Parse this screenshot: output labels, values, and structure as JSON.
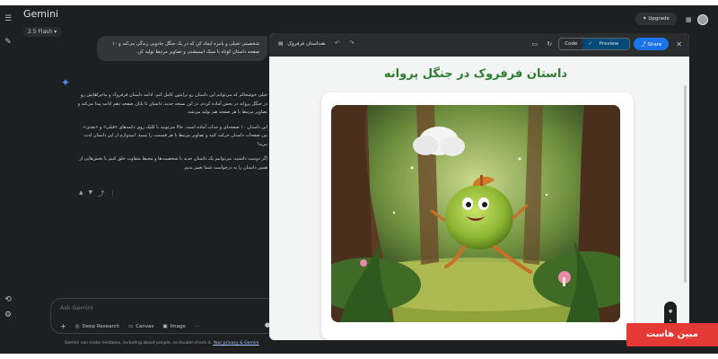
{
  "app": {
    "name": "Gemini",
    "model": "2.5 Flash ▾"
  },
  "header": {
    "upgrade_label": "Upgrade"
  },
  "chat": {
    "user_message": "شخصیتی تخیلی و بامزه ایجاد کن که در یک جنگل جادویی زندگی می‌کند و ۱۰ صفحه داستان کوتاه با سبک انیمیشنی و تصاویر مرتبط تولید کن.",
    "reply_paragraphs": [
      "خیلی خوشحالم که می‌توانم این داستان رو برایتون کامل کنم. ادامه داستان فرفروک و ماجراهایش رو در جنگل پروانه در بخش آماده کردم. در این نسخه جدید، داستان تا پایان صفحه دهم ادامه پیدا می‌کنه و تصاویر مرتبط با هر صفحه هم تولید می‌شه.",
      "این داستان ۱۰ صفحه‌ای و جذاب آماده است. حالا می‌تونید با کلیک روی دکمه‌های «قبلی» و «بعدی»، بین صفحات داستان حرکت کنید و تصاویر مرتبط با هر قسمت را ببینید. امیدوارم از این داستان لذت ببرید!",
      "اگر دوست داشتید، می‌توانیم یک داستان جدید با شخصیت‌ها و محیط متفاوت خلق کنیم یا بخش‌هایی از همین داستان را به درخواست شما تغییر بدیم."
    ]
  },
  "input": {
    "placeholder": "Ask Gemini",
    "tools": [
      "Deep Research",
      "Canvas",
      "Image"
    ],
    "more": "···"
  },
  "disclaimer": {
    "text": "Gemini can make mistakes, including about people, so double-check it. ",
    "link": "Your privacy & Gemini"
  },
  "canvas": {
    "file_name": "داستان فرفروک",
    "code_label": "Code",
    "preview_label": "Preview",
    "share_label": "Share",
    "story_title": "داستان فرفروک در جنگل پروانه"
  },
  "watermark": {
    "text": "مبین هاست"
  },
  "colors": {
    "accent": "#1a73e8",
    "title_green": "#2e7d32",
    "bg_dark": "#1e1f20"
  },
  "icons": {
    "menu": "☰",
    "edit": "✎",
    "history": "⟲",
    "settings": "⚙",
    "gemini_spark": "✦",
    "like": "👍",
    "dislike": "👎",
    "share": "⤴",
    "more": "⋮",
    "plus": "+",
    "mic": "🎤",
    "cloud": "☁",
    "undo": "↶",
    "redo": "↷",
    "doc": "▤",
    "refresh": "↻",
    "close": "✕"
  }
}
